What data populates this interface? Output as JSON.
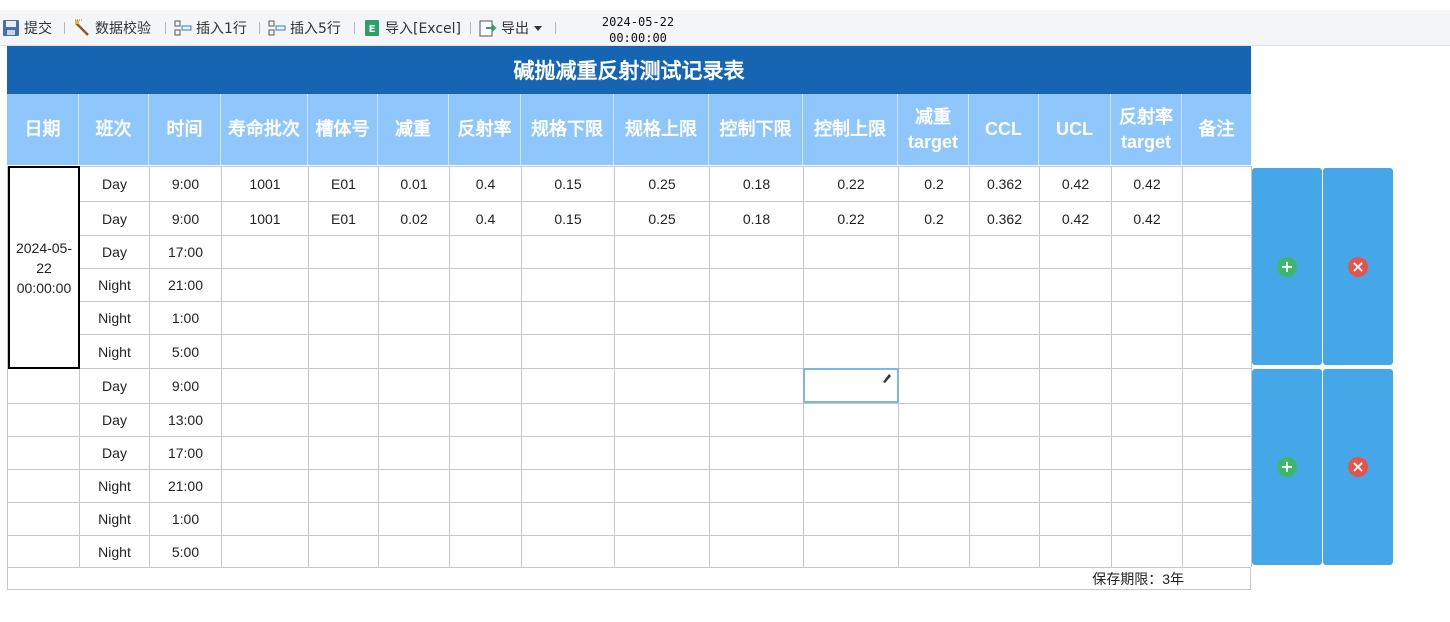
{
  "toolbar": {
    "submit": "提交",
    "validate": "数据校验",
    "insert1": "插入1行",
    "insert5": "插入5行",
    "import": "导入[Excel]",
    "export": "导出",
    "date_line1": "2024-05-22",
    "date_line2": "00:00:00"
  },
  "title": "碱抛减重反射测试记录表",
  "headers": {
    "date": "日期",
    "shift": "班次",
    "time": "时间",
    "life_batch": "寿命批次",
    "tank": "槽体号",
    "weight_loss": "减重",
    "reflectance": "反射率",
    "spec_low": "规格下限",
    "spec_high": "规格上限",
    "ctrl_low": "控制下限",
    "ctrl_high": "控制上限",
    "wl_target_1": "减重",
    "wl_target_2": "target",
    "ccl": "CCL",
    "ucl": "UCL",
    "refl_target_1": "反射率",
    "refl_target_2": "target",
    "remark": "备注"
  },
  "date_cell": {
    "line1": "2024-05-",
    "line2": "22",
    "line3": "00:00:00"
  },
  "rows": [
    {
      "shift": "Day",
      "time": "9:00",
      "batch": "1001",
      "tank": "E01",
      "wl": "0.01",
      "refl": "0.4",
      "slo": "0.15",
      "shi": "0.25",
      "clo": "0.18",
      "chi": "0.22",
      "wlt": "0.2",
      "ccl": "0.362",
      "ucl": "0.42",
      "rt": "0.42"
    },
    {
      "shift": "Day",
      "time": "9:00",
      "batch": "1001",
      "tank": "E01",
      "wl": "0.02",
      "refl": "0.4",
      "slo": "0.15",
      "shi": "0.25",
      "clo": "0.18",
      "chi": "0.22",
      "wlt": "0.2",
      "ccl": "0.362",
      "ucl": "0.42",
      "rt": "0.42"
    },
    {
      "shift": "Day",
      "time": "17:00"
    },
    {
      "shift": "Night",
      "time": "21:00"
    },
    {
      "shift": "Night",
      "time": "1:00"
    },
    {
      "shift": "Night",
      "time": "5:00"
    },
    {
      "shift": "Day",
      "time": "9:00"
    },
    {
      "shift": "Day",
      "time": "13:00"
    },
    {
      "shift": "Day",
      "time": "17:00"
    },
    {
      "shift": "Night",
      "time": "21:00"
    },
    {
      "shift": "Night",
      "time": "1:00"
    },
    {
      "shift": "Night",
      "time": "5:00"
    }
  ],
  "footer": "保存期限：3年",
  "side_buttons": {
    "add_glyph": "+",
    "delete_glyph": "×"
  },
  "colors": {
    "title_bg": "#1565b3",
    "header_bg": "#8fc6fb",
    "side_btn": "#46a7e8",
    "add_icon": "#3db86b",
    "delete_icon": "#e5534b"
  }
}
